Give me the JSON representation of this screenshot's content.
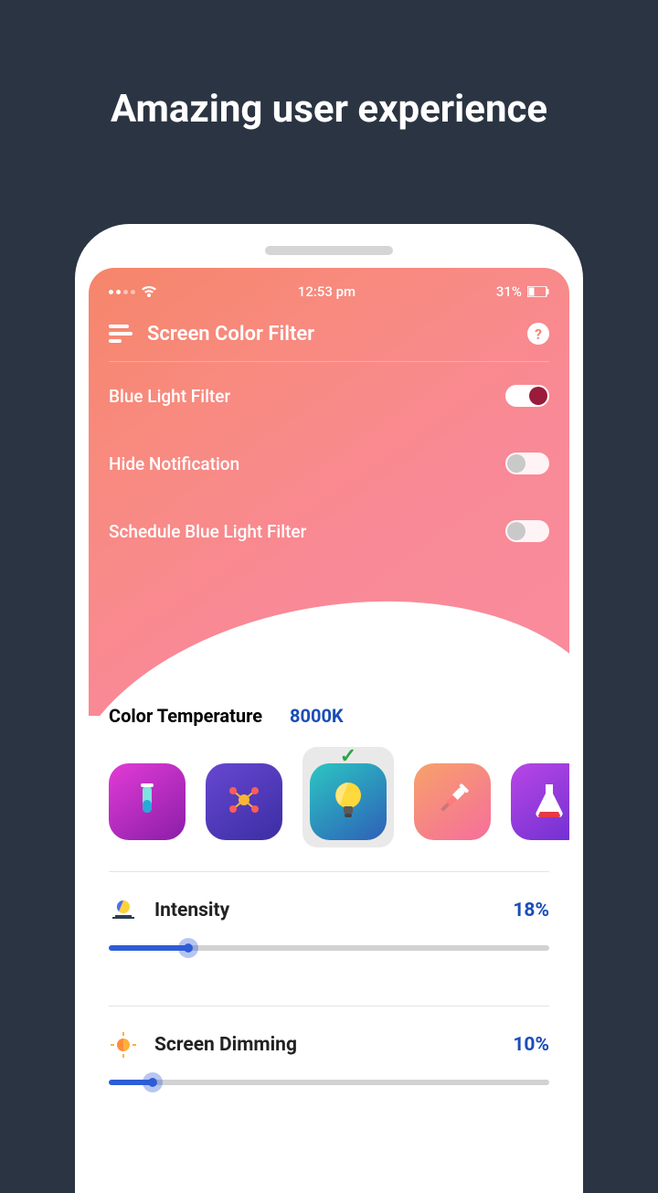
{
  "headline": "Amazing user experience",
  "statusbar": {
    "time": "12:53 pm",
    "battery": "31%"
  },
  "app": {
    "title": "Screen Color Filter"
  },
  "settings": [
    {
      "label": "Blue Light Filter",
      "on": true
    },
    {
      "label": "Hide Notification",
      "on": false
    },
    {
      "label": "Schedule Blue Light Filter",
      "on": false
    }
  ],
  "temperature": {
    "label": "Color Temperature",
    "value": "8000K"
  },
  "presets": {
    "selected_index": 2,
    "items": [
      "test-tube",
      "molecule",
      "lightbulb",
      "syringe",
      "flask"
    ]
  },
  "sliders": {
    "intensity": {
      "label": "Intensity",
      "value": "18%",
      "percent": 18
    },
    "dimming": {
      "label": "Screen Dimming",
      "value": "10%",
      "percent": 10
    }
  }
}
